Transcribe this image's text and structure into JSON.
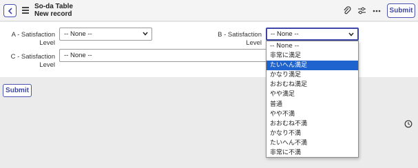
{
  "header": {
    "table_name": "So-da Table",
    "record_title": "New record",
    "submit_label": "Submit",
    "icons": [
      "back-icon",
      "menu-icon",
      "paperclip-icon",
      "sliders-icon",
      "more-icon"
    ]
  },
  "form": {
    "field_a": {
      "label_line1": "A - Satisfaction",
      "label_line2": "Level",
      "value": "-- None --"
    },
    "field_b": {
      "label_line1": "B - Satisfaction",
      "label_line2": "Level",
      "value": "-- None --"
    },
    "field_c": {
      "label_line1": "C - Satisfaction",
      "label_line2": "Level",
      "value": "-- None --"
    },
    "submit_label": "Submit"
  },
  "dropdown": {
    "highlighted_index": 2,
    "options": [
      "-- None --",
      "非常に満足",
      "たいへん満足",
      "かなり満足",
      "おおむね満足",
      "やや満足",
      "普通",
      "やや不満",
      "おおむね不満",
      "かなり不満",
      "たいへん不満",
      "非常に不満"
    ]
  },
  "colors": {
    "accent": "#3d46a8",
    "highlight": "#1f63cf",
    "page_bg": "#ebebeb"
  }
}
